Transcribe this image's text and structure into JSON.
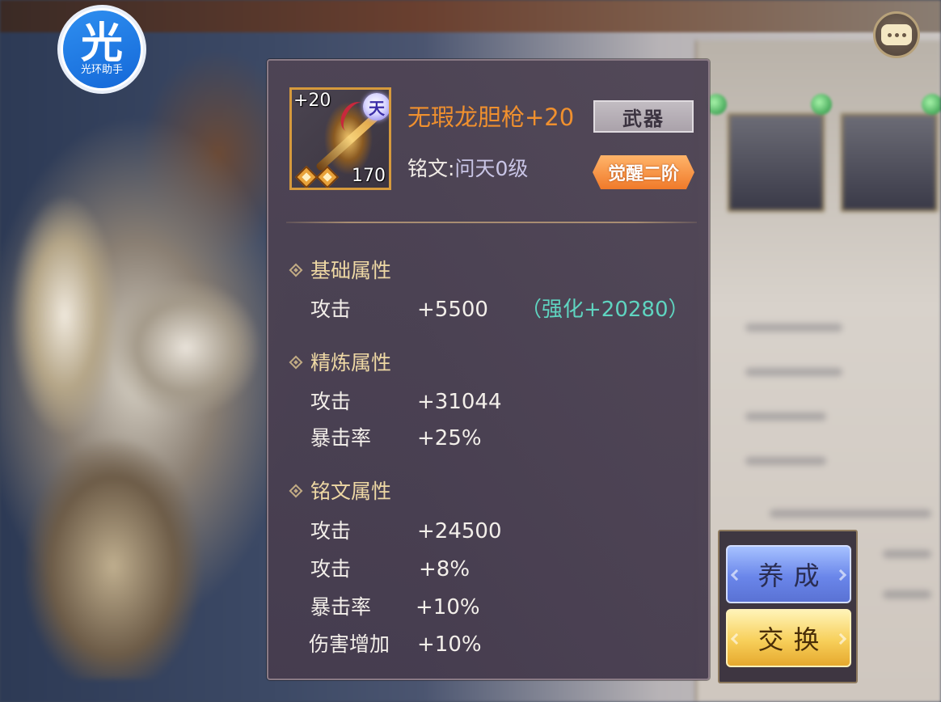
{
  "logo": {
    "char": "光",
    "text": "光环助手"
  },
  "item": {
    "enhance_level": "+20",
    "sky_badge": "天",
    "count": "170",
    "name": "无瑕龙胆枪+20",
    "type_label": "武器",
    "inscription_label": "铭文:",
    "inscription_value": "问天0级",
    "awaken_label": "觉醒二阶"
  },
  "sections": {
    "base": {
      "title": "基础属性",
      "stats": [
        {
          "name": "攻击",
          "value": "+5500",
          "extra": "（强化+20280）"
        }
      ]
    },
    "refine": {
      "title": "精炼属性",
      "stats": [
        {
          "name": "攻击",
          "value": "+31044"
        },
        {
          "name": "暴击率",
          "value": "+25%"
        }
      ]
    },
    "inscription": {
      "title": "铭文属性",
      "stats": [
        {
          "name": "攻击",
          "value": "+24500"
        },
        {
          "name": "攻击",
          "value": "+8%"
        },
        {
          "name": "暴击率",
          "value": "+10%"
        },
        {
          "name": "伤害增加",
          "value": "+10%"
        }
      ]
    }
  },
  "actions": {
    "train_label": "养成",
    "exchange_label": "交换"
  },
  "colors": {
    "item_name": "#f0902e",
    "enhance_extra": "#5fd4c0",
    "section_title": "#eed8a4",
    "awaken_badge": "#f07a2a",
    "train_button": "#6a86ea",
    "exchange_button": "#f7cf5a"
  },
  "icons": [
    "sky-rank-icon",
    "gem-icon",
    "diamond-bullet-icon",
    "chat-icon"
  ]
}
